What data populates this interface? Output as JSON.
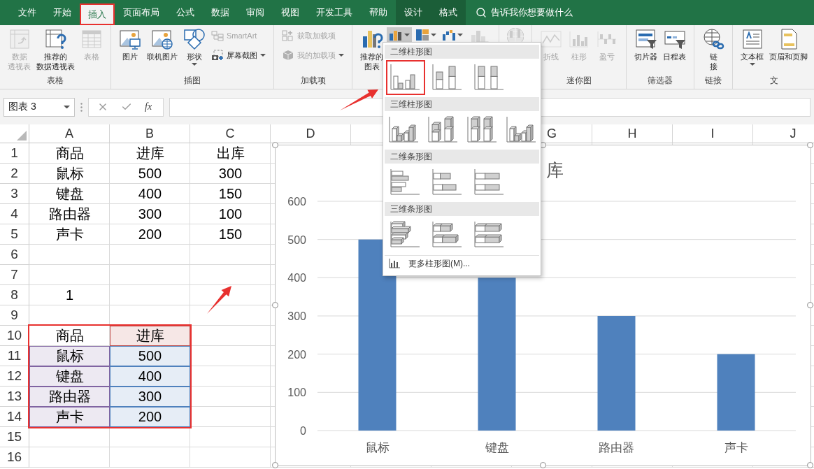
{
  "tabs": [
    {
      "label": "文件",
      "selected": false,
      "contextual": false
    },
    {
      "label": "开始",
      "selected": false,
      "contextual": false
    },
    {
      "label": "插入",
      "selected": true,
      "contextual": false
    },
    {
      "label": "页面布局",
      "selected": false,
      "contextual": false
    },
    {
      "label": "公式",
      "selected": false,
      "contextual": false
    },
    {
      "label": "数据",
      "selected": false,
      "contextual": false
    },
    {
      "label": "审阅",
      "selected": false,
      "contextual": false
    },
    {
      "label": "视图",
      "selected": false,
      "contextual": false
    },
    {
      "label": "开发工具",
      "selected": false,
      "contextual": false
    },
    {
      "label": "帮助",
      "selected": false,
      "contextual": false
    },
    {
      "label": "设计",
      "selected": false,
      "contextual": true
    },
    {
      "label": "格式",
      "selected": false,
      "contextual": true
    }
  ],
  "tell_me": {
    "placeholder": "告诉我你想要做什么"
  },
  "ribbon": {
    "groups": [
      {
        "label": "表格",
        "items": [
          {
            "kind": "large",
            "lines": [
              "数据",
              "透视表"
            ],
            "disabled": true
          },
          {
            "kind": "large",
            "lines": [
              "推荐的",
              "数据透视表"
            ],
            "disabled": false
          },
          {
            "kind": "large",
            "lines": [
              "表格"
            ],
            "disabled": true
          }
        ]
      },
      {
        "label": "插图",
        "items": [
          {
            "kind": "large",
            "lines": [
              "图片"
            ],
            "disabled": false
          },
          {
            "kind": "large",
            "lines": [
              "联机图片"
            ],
            "disabled": false
          },
          {
            "kind": "large",
            "lines": [
              "形状"
            ],
            "disabled": false,
            "dropdown": true
          },
          {
            "kind": "stack",
            "items": [
              {
                "label": "SmartArt",
                "disabled": true
              },
              {
                "label": "屏幕截图",
                "disabled": false,
                "dropdown": true
              }
            ]
          }
        ]
      },
      {
        "label": "加载项",
        "items": [
          {
            "kind": "stack",
            "items": [
              {
                "label": "获取加载项",
                "disabled": true
              },
              {
                "label": "我的加载项",
                "disabled": true,
                "dropdown": true
              }
            ]
          }
        ]
      },
      {
        "items": [
          {
            "kind": "large",
            "lines": [
              "推荐的",
              "图表"
            ],
            "disabled": false
          },
          {
            "kind": "icon-row",
            "items": [
              {
                "pressed": true,
                "dropdown": true
              },
              {
                "pressed": false,
                "dropdown": true
              },
              {
                "pressed": false,
                "dropdown": true
              }
            ]
          },
          {
            "kind": "large",
            "disabled": true
          }
        ]
      },
      {
        "items": [
          {
            "kind": "large",
            "disabled": true
          }
        ]
      },
      {
        "label": "迷你图",
        "items": [
          {
            "kind": "large",
            "lines": [
              "折线"
            ],
            "disabled": true
          },
          {
            "kind": "large",
            "lines": [
              "柱形"
            ],
            "disabled": true
          },
          {
            "kind": "large",
            "lines": [
              "盈亏"
            ],
            "disabled": true
          }
        ]
      },
      {
        "label": "筛选器",
        "items": [
          {
            "kind": "large",
            "lines": [
              "切片器"
            ],
            "disabled": false
          },
          {
            "kind": "large",
            "lines": [
              "日程表"
            ],
            "disabled": false
          }
        ]
      },
      {
        "label": "链接",
        "items": [
          {
            "kind": "large",
            "lines": [
              "链",
              "接"
            ],
            "disabled": false
          }
        ]
      },
      {
        "label": "文",
        "items": [
          {
            "kind": "large",
            "lines": [
              "文本框"
            ],
            "disabled": false,
            "dropdown": true
          },
          {
            "kind": "large",
            "lines": [
              "页眉和页脚"
            ],
            "disabled": false
          }
        ]
      }
    ]
  },
  "formula_bar": {
    "name_box": "图表 3",
    "function_label": "fx"
  },
  "sheet": {
    "columns": [
      {
        "label": "A"
      },
      {
        "label": "B"
      },
      {
        "label": "C"
      },
      {
        "label": "D"
      },
      null,
      null,
      {
        "label": "G"
      },
      {
        "label": "H"
      },
      {
        "label": "I"
      },
      {
        "label": "J"
      }
    ],
    "rows": [
      {
        "number": "1",
        "cells": [
          {
            "text": "商品"
          },
          {
            "text": "进库"
          },
          {
            "text": "出库"
          }
        ]
      },
      {
        "number": "2",
        "cells": [
          {
            "text": "鼠标"
          },
          {
            "text": "500"
          },
          {
            "text": "300"
          }
        ]
      },
      {
        "number": "3",
        "cells": [
          {
            "text": "键盘"
          },
          {
            "text": "400"
          },
          {
            "text": "150"
          }
        ]
      },
      {
        "number": "4",
        "cells": [
          {
            "text": "路由器"
          },
          {
            "text": "300"
          },
          {
            "text": "100"
          }
        ]
      },
      {
        "number": "5",
        "cells": [
          {
            "text": "声卡"
          },
          {
            "text": "200"
          },
          {
            "text": "150"
          }
        ]
      },
      {
        "number": "6"
      },
      {
        "number": "7"
      },
      {
        "number": "8",
        "cells": [
          {
            "text": "1"
          }
        ]
      },
      {
        "number": "9"
      },
      {
        "number": "10",
        "cells": [
          {
            "text": "商品"
          },
          {
            "text": "进库",
            "color": "#c0504d"
          }
        ]
      },
      {
        "number": "11",
        "cells": [
          {
            "text": "鼠标",
            "color": "#8064a2"
          },
          {
            "text": "500",
            "color": "#4f81bd"
          }
        ]
      },
      {
        "number": "12",
        "cells": [
          {
            "text": "键盘",
            "color": "#8064a2"
          },
          {
            "text": "400",
            "color": "#4f81bd"
          }
        ]
      },
      {
        "number": "13",
        "cells": [
          {
            "text": "路由器",
            "color": "#8064a2"
          },
          {
            "text": "300",
            "color": "#4f81bd"
          }
        ]
      },
      {
        "number": "14",
        "cells": [
          {
            "text": "声卡",
            "color": "#8064a2"
          },
          {
            "text": "200",
            "color": "#4f81bd"
          }
        ]
      },
      {
        "number": "15"
      },
      {
        "number": "16"
      }
    ]
  },
  "chart": {
    "chart_data": {
      "type": "bar",
      "title": "库",
      "categories": [
        "鼠标",
        "键盘",
        "路由器",
        "声卡"
      ],
      "series": [
        {
          "color": "#4f81bd",
          "values": [
            500,
            400,
            300,
            200
          ]
        }
      ],
      "grid": true,
      "ylim": [
        0,
        600
      ],
      "yticks": [
        0,
        100,
        200,
        300,
        400,
        500,
        600
      ]
    }
  },
  "chart_menu": {
    "sections": [
      {
        "title": "二维柱形图",
        "options": [
          {
            "selected": true
          },
          {
            "selected": false
          },
          {
            "selected": false
          }
        ]
      },
      {
        "title": "三维柱形图",
        "options": [
          {
            "selected": false
          },
          {
            "selected": false
          },
          {
            "selected": false
          },
          {
            "selected": false
          }
        ]
      },
      {
        "title": "二维条形图",
        "options": [
          {
            "selected": false
          },
          {
            "selected": false
          },
          {
            "selected": false
          }
        ]
      },
      {
        "title": "三维条形图",
        "options": [
          {
            "selected": false
          },
          {
            "selected": false
          },
          {
            "selected": false
          }
        ]
      }
    ],
    "more": "更多柱形图(M)..."
  }
}
